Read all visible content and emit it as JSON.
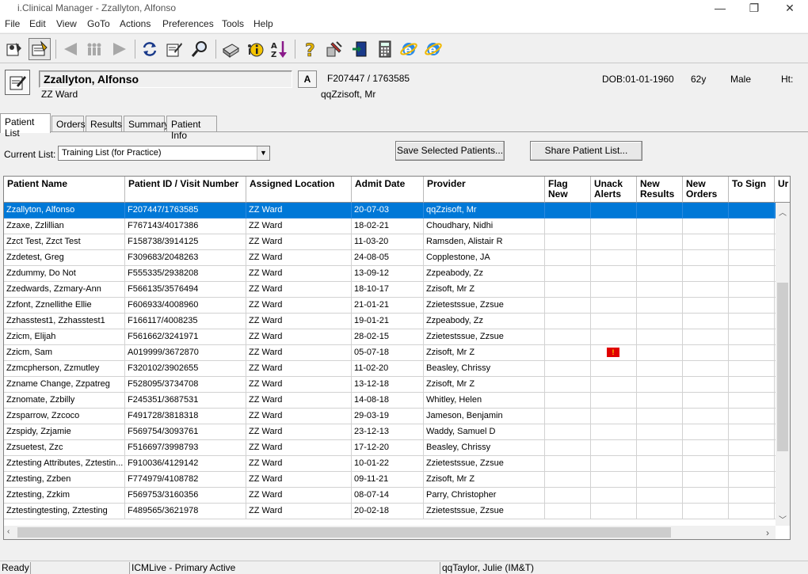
{
  "window": {
    "title": "i.Clinical Manager - Zzallyton, Alfonso",
    "minimize": "—",
    "restore": "❐",
    "close": "✕"
  },
  "menu": [
    "File",
    "Edit",
    "View",
    "GoTo",
    "Actions",
    "Preferences",
    "Tools",
    "Help"
  ],
  "toolbar": {
    "icons": [
      "users-icon",
      "patient-list-icon",
      "back-arrow-icon",
      "people-icon",
      "forward-arrow-icon",
      "refresh-icon",
      "edit-notes-icon",
      "search-icon",
      "print-icon",
      "info-icon",
      "sort-az-icon",
      "help-icon",
      "tools-icon",
      "exit-icon",
      "calculator-icon",
      "internet-explorer-icon",
      "internet-explorer-2-icon"
    ]
  },
  "patient": {
    "name": "Zzallyton, Alfonso",
    "ward": "ZZ Ward",
    "a_button": "A",
    "ids": "F207447 / 1763585",
    "consultant": "qqZzisoft, Mr",
    "dob": "DOB:01-01-1960",
    "age": "62y",
    "sex": "Male",
    "ht": "Ht:"
  },
  "tabs": [
    "Patient List",
    "Orders",
    "Results",
    "Summary",
    "Patient Info"
  ],
  "list_controls": {
    "current_list_label": "Current List:",
    "current_list_value": "Training List (for Practice)",
    "save_button": "Save Selected Patients...",
    "share_button": "Share Patient List..."
  },
  "grid": {
    "columns": [
      "Patient Name",
      "Patient ID / Visit Number",
      "Assigned Location",
      "Admit Date",
      "Provider",
      "Flag New",
      "Unack Alerts",
      "New Results",
      "New Orders",
      "To Sign",
      "Ur"
    ],
    "rows": [
      [
        "Zzallyton, Alfonso",
        "F207447/1763585",
        "ZZ Ward",
        "20-07-03",
        "qqZzisoft, Mr"
      ],
      [
        "Zzaxe, Zzlillian",
        "F767143/4017386",
        "ZZ Ward",
        "18-02-21",
        "Choudhary, Nidhi"
      ],
      [
        "Zzct Test, Zzct Test",
        "F158738/3914125",
        "ZZ Ward",
        "11-03-20",
        "Ramsden, Alistair R"
      ],
      [
        "Zzdetest, Greg",
        "F309683/2048263",
        "ZZ Ward",
        "24-08-05",
        "Copplestone, JA"
      ],
      [
        "Zzdummy, Do Not",
        "F555335/2938208",
        "ZZ Ward",
        "13-09-12",
        "Zzpeabody, Zz"
      ],
      [
        "Zzedwards, Zzmary-Ann",
        "F566135/3576494",
        "ZZ Ward",
        "18-10-17",
        "Zzisoft, Mr Z"
      ],
      [
        "Zzfont, Zznellithe Ellie",
        "F606933/4008960",
        "ZZ Ward",
        "21-01-21",
        "Zzietestssue, Zzsue"
      ],
      [
        "Zzhasstest1, Zzhasstest1",
        "F166117/4008235",
        "ZZ Ward",
        "19-01-21",
        "Zzpeabody, Zz"
      ],
      [
        "Zzicm, Elijah",
        "F561662/3241971",
        "ZZ Ward",
        "28-02-15",
        "Zzietestssue, Zzsue"
      ],
      [
        "Zzicm, Sam",
        "A019999/3672870",
        "ZZ Ward",
        "05-07-18",
        "Zzisoft, Mr Z"
      ],
      [
        "Zzmcpherson, Zzmutley",
        "F320102/3902655",
        "ZZ Ward",
        "11-02-20",
        "Beasley, Chrissy"
      ],
      [
        "Zzname Change, Zzpatreg",
        "F528095/3734708",
        "ZZ Ward",
        "13-12-18",
        "Zzisoft, Mr Z"
      ],
      [
        "Zznomate, Zzbilly",
        "F245351/3687531",
        "ZZ Ward",
        "14-08-18",
        "Whitley, Helen"
      ],
      [
        "Zzsparrow, Zzcoco",
        "F491728/3818318",
        "ZZ Ward",
        "29-03-19",
        "Jameson, Benjamin"
      ],
      [
        "Zzspidy, Zzjamie",
        "F569754/3093761",
        "ZZ Ward",
        "23-12-13",
        "Waddy, Samuel D"
      ],
      [
        "Zzsuetest, Zzc",
        "F516697/3998793",
        "ZZ Ward",
        "17-12-20",
        "Beasley, Chrissy"
      ],
      [
        "Zztesting Attributes, Zztestin...",
        "F910036/4129142",
        "ZZ Ward",
        "10-01-22",
        "Zzietestssue, Zzsue"
      ],
      [
        "Zztesting, Zzben",
        "F774979/4108782",
        "ZZ Ward",
        "09-11-21",
        "Zzisoft, Mr Z"
      ],
      [
        "Zztesting, Zzkim",
        "F569753/3160356",
        "ZZ Ward",
        "08-07-14",
        "Parry, Christopher"
      ],
      [
        "Zztestingtesting, Zztesting",
        "F489565/3621978",
        "ZZ Ward",
        "20-02-18",
        "Zzietestssue, Zzsue"
      ]
    ],
    "alert_row": 9,
    "selected_row": 0
  },
  "status": {
    "ready": "Ready",
    "environment": "ICMLive - Primary Active",
    "user": "qqTaylor, Julie (IM&T)"
  }
}
